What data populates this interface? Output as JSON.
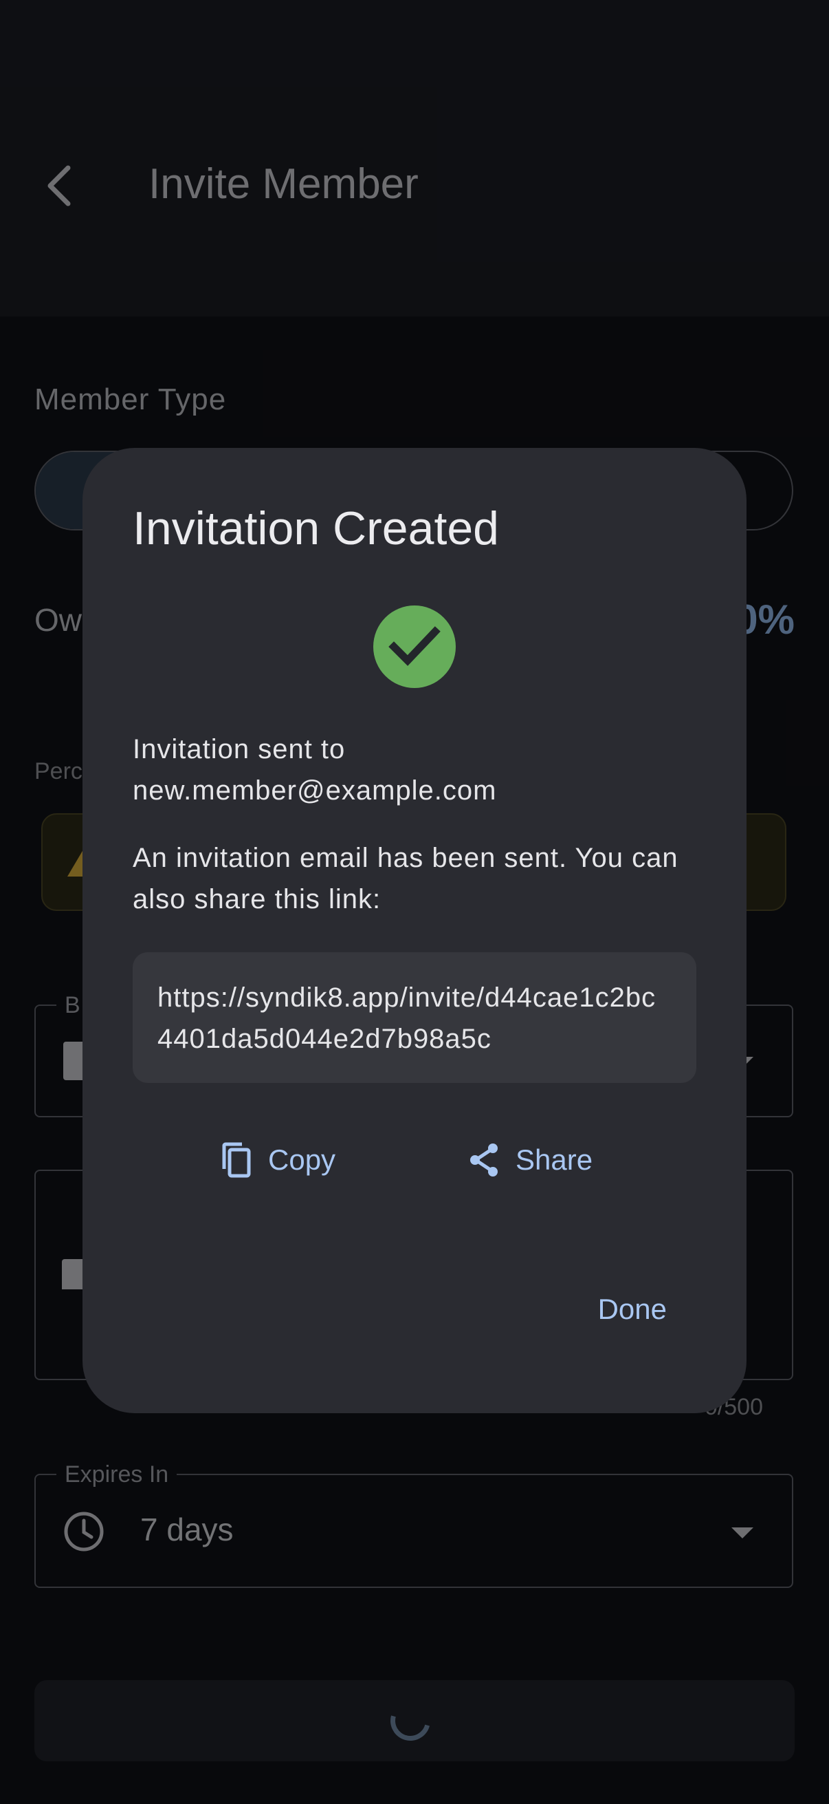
{
  "appbar": {
    "title": "Invite Member"
  },
  "form": {
    "member_type_label": "Member Type",
    "ownership_label": "Ow",
    "ownership_value": "0%",
    "percent_label": "Perc",
    "building_legend": "B",
    "message_counter": "0/500",
    "expires_legend": "Expires In",
    "expires_value": "7 days"
  },
  "dialog": {
    "title": "Invitation Created",
    "sent_line1": "Invitation sent to",
    "sent_line2": "new.member@example.com",
    "info_text": "An invitation email has been sent. You can also share this link:",
    "link": "https://syndik8.app/invite/d44cae1c2bc4401da5d044e2d7b98a5c",
    "copy_label": "Copy",
    "share_label": "Share",
    "done_label": "Done"
  },
  "colors": {
    "accent": "#a9c7f2",
    "success": "#66ad5a",
    "dialog_bg": "#2a2b31",
    "screen_bg": "#101116"
  },
  "icons": {
    "back": "chevron-left-icon",
    "success": "check-circle-icon",
    "copy": "copy-icon",
    "share": "share-icon",
    "clock": "clock-icon",
    "warning": "warning-icon"
  }
}
